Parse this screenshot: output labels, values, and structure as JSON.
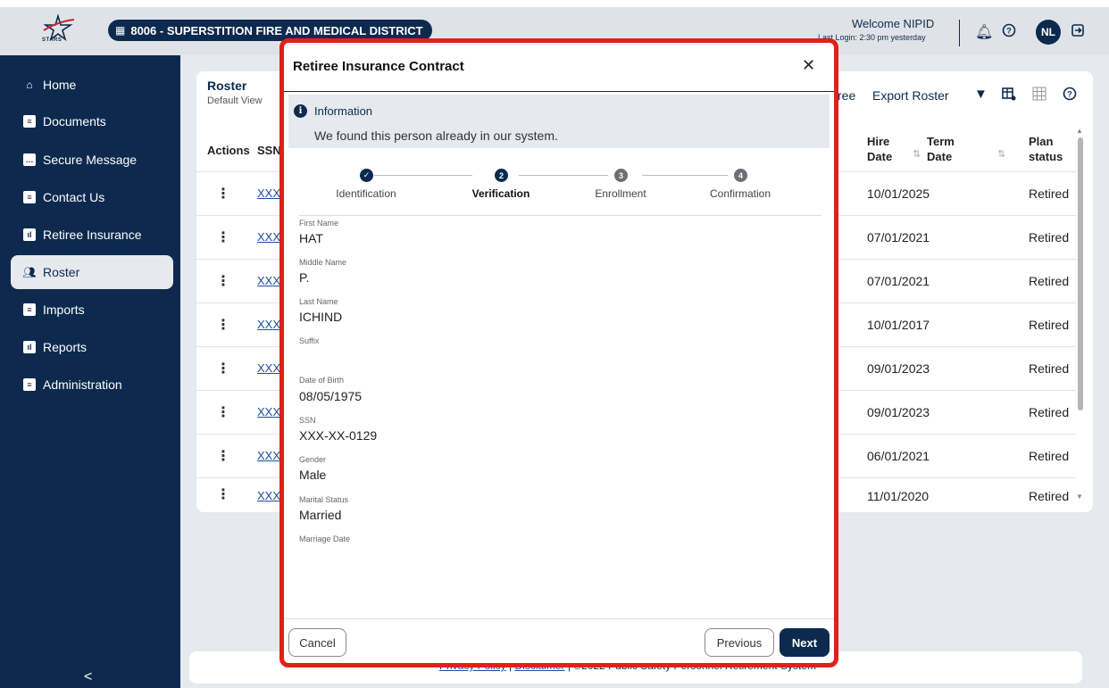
{
  "header": {
    "district": "8006 - SUPERSTITION FIRE AND MEDICAL DISTRICT",
    "logo_text": "STARS",
    "welcome": "Welcome NIPID",
    "last_login": "Last Login: 2:30 pm yesterday",
    "avatar_initials": "NL"
  },
  "sidebar": {
    "items": [
      {
        "label": "Home",
        "icon": "home-icon"
      },
      {
        "label": "Documents",
        "icon": "document-icon"
      },
      {
        "label": "Secure Message",
        "icon": "message-icon"
      },
      {
        "label": "Contact Us",
        "icon": "chat-icon"
      },
      {
        "label": "Retiree Insurance",
        "icon": "chart-icon"
      },
      {
        "label": "Roster",
        "icon": "people-icon"
      },
      {
        "label": "Imports",
        "icon": "clipboard-icon"
      },
      {
        "label": "Reports",
        "icon": "chart-icon"
      },
      {
        "label": "Administration",
        "icon": "clipboard-icon"
      }
    ],
    "active": "Roster",
    "collapse": "<"
  },
  "roster": {
    "title": "Roster",
    "view": "Default View",
    "toolbar": {
      "add_retiree": "ree",
      "export": "Export Roster"
    },
    "columns": {
      "actions": "Actions",
      "ssn": "SSN",
      "hire_date": "Hire Date",
      "term_date": "Term Date",
      "plan_status": "Plan status"
    },
    "rows": [
      {
        "ssn": "XXX",
        "hire": "10/01/2025",
        "status": "Retired"
      },
      {
        "ssn": "XXX",
        "hire": "07/01/2021",
        "status": "Retired"
      },
      {
        "ssn": "XXX",
        "hire": "07/01/2021",
        "status": "Retired"
      },
      {
        "ssn": "XXX",
        "hire": "10/01/2017",
        "status": "Retired"
      },
      {
        "ssn": "XXX",
        "hire": "09/01/2023",
        "status": "Retired"
      },
      {
        "ssn": "XXX",
        "hire": "09/01/2023",
        "status": "Retired"
      },
      {
        "ssn": "XXX",
        "hire": "06/01/2021",
        "status": "Retired"
      },
      {
        "ssn": "XXX",
        "hire": "11/01/2020",
        "status": "Retired"
      }
    ]
  },
  "footer": {
    "privacy": "Privacy Policy",
    "sep": "|",
    "disclaimer": "Disclaimer",
    "copyright": "| ©2022 Public Safety Personnel Retirement System"
  },
  "modal": {
    "title": "Retiree Insurance Contract",
    "close": "✕",
    "info_title": "Information",
    "info_message": "We found this person already in our system.",
    "steps": [
      {
        "num": "✓",
        "label": "Identification"
      },
      {
        "num": "2",
        "label": "Verification"
      },
      {
        "num": "3",
        "label": "Enrollment"
      },
      {
        "num": "4",
        "label": "Confirmation"
      }
    ],
    "fields": {
      "first_name": {
        "label": "First Name",
        "value": "HAT"
      },
      "middle_name": {
        "label": "Middle Name",
        "value": "P."
      },
      "last_name": {
        "label": "Last Name",
        "value": "ICHIND"
      },
      "suffix": {
        "label": "Suffix",
        "value": ""
      },
      "dob": {
        "label": "Date of Birth",
        "value": "08/05/1975"
      },
      "ssn": {
        "label": "SSN",
        "value": "XXX-XX-0129"
      },
      "gender": {
        "label": "Gender",
        "value": "Male"
      },
      "marital": {
        "label": "Marital Status",
        "value": "Married"
      },
      "marriage_date": {
        "label": "Marriage Date",
        "value": ""
      }
    },
    "buttons": {
      "cancel": "Cancel",
      "previous": "Previous",
      "next": "Next"
    }
  },
  "colors": {
    "navy": "#0d2a4e",
    "highlight_border": "#e0201b",
    "panel": "#e6e9ee"
  }
}
